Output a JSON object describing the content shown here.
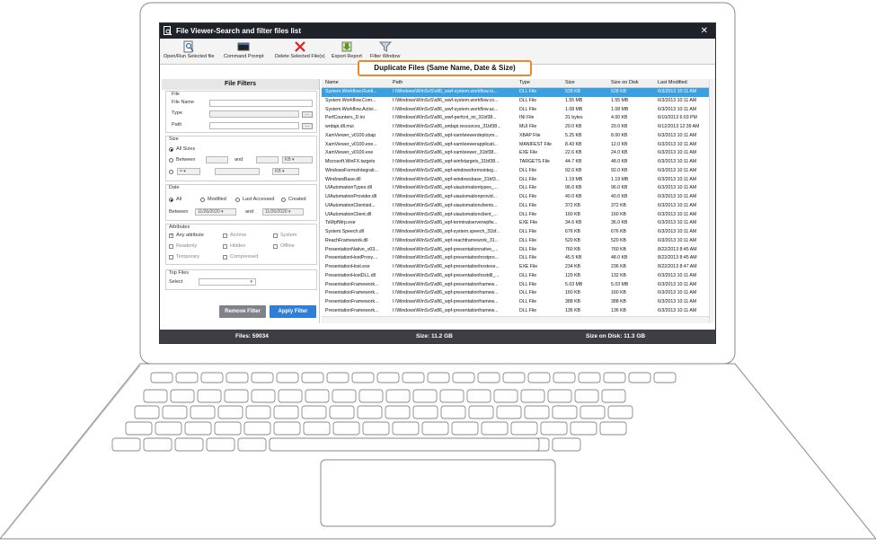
{
  "window": {
    "title": "File Viewer-Search and filter files list",
    "close_glyph": "✕"
  },
  "toolbar": {
    "buttons": [
      {
        "label": "Open/Run Selected file",
        "icon": "open-file-icon"
      },
      {
        "label": "Command Prompt",
        "icon": "command-prompt-icon"
      },
      {
        "label": "Delete Selected File(s)",
        "icon": "delete-icon"
      },
      {
        "label": "Export Report",
        "icon": "export-icon"
      },
      {
        "label": "Filter Window",
        "icon": "filter-icon"
      }
    ]
  },
  "banner": "Duplicate Files (Same Name, Date & Size)",
  "filters": {
    "heading": "File Filters",
    "file": {
      "group_label": "File",
      "name_label": "File Name",
      "type_label": "Type",
      "path_label": "Path",
      "browse": "..."
    },
    "size": {
      "group_label": "Size",
      "all_sizes": "All Sizes",
      "between": "Between",
      "and": "and",
      "unit": "KB",
      "operator": "=",
      "unit2": "KB"
    },
    "date": {
      "group_label": "Date",
      "all": "All",
      "modified": "Modified",
      "last_accessed": "Last Accessed",
      "created": "Created",
      "between": "Between",
      "from": "11/26/2020",
      "and": "and",
      "to": "11/26/2020"
    },
    "attributes": {
      "group_label": "Attributes",
      "items": [
        "Any attribute",
        "Archive",
        "System",
        "Readonly",
        "Hidden",
        "Offline",
        "Temporary",
        "Compressed"
      ],
      "checked": "Any attribute"
    },
    "top_files": {
      "group_label": "Top Files",
      "select_label": "Select"
    },
    "remove_button": "Remove Filter",
    "apply_button": "Apply Filter"
  },
  "table": {
    "columns": [
      "Name",
      "Path",
      "Type",
      "Size",
      "Size on Disk",
      "Last Modified"
    ],
    "rows": [
      [
        "System.Workflow.Runti...",
        "I:\\Windows\\WinSxS\\x86_wwf-system.workflow.ru...",
        "DLL File",
        "528 KB",
        "528 KB",
        "6/3/2013 10:11 AM"
      ],
      [
        "System.Workflow.Com...",
        "I:\\Windows\\WinSxS\\x86_wwf-system.workflow.co...",
        "DLL File",
        "1.55 MB",
        "1.55 MB",
        "6/3/2013 10:11 AM"
      ],
      [
        "System.Workflow.Activi...",
        "I:\\Windows\\WinSxS\\x86_wwf-system.workflow.ac...",
        "DLL File",
        "1.08 MB",
        "1.08 MB",
        "6/3/2013 10:11 AM"
      ],
      [
        "PerfCounters_D.ini",
        "I:\\Windows\\WinSxS\\x86_wwf-perfcnt_ini_31bf38...",
        "INI File",
        "31 bytes",
        "4.00 KB",
        "6/10/2013 6:03 PM"
      ],
      [
        "wrdapi.dll.mui",
        "I:\\Windows\\WinSxS\\x86_wrdapi.resources_31bf38...",
        "MUI File",
        "20.0 KB",
        "20.0 KB",
        "6/12/2013 12:39 AM"
      ],
      [
        "XamViewer_v0100.xbap",
        "I:\\Windows\\WinSxS\\x86_wpf-xamlviewerdeploym...",
        "XBAP File",
        "5.25 KB",
        "8.00 KB",
        "6/3/2013 10:11 AM"
      ],
      [
        "XamViewer_v0100.exe...",
        "I:\\Windows\\WinSxS\\x86_wpf-xamlviewerapplicati...",
        "MANIFEST File",
        "8.43 KB",
        "12.0 KB",
        "6/3/2013 10:11 AM"
      ],
      [
        "XamViewer_v0100.exe",
        "I:\\Windows\\WinSxS\\x86_wpf-xamlviewer_31bf38...",
        "EXE File",
        "22.6 KB",
        "24.0 KB",
        "6/3/2013 10:11 AM"
      ],
      [
        "Microsoft.WinFX.targets",
        "I:\\Windows\\WinSxS\\x86_wpf-winfxtargets_31bf38...",
        "TARGETS File",
        "44.7 KB",
        "48.0 KB",
        "6/3/2013 10:11 AM"
      ],
      [
        "WindowsFormsIntegrati...",
        "I:\\Windows\\WinSxS\\x86_wpf-windowsformsinteg...",
        "DLL File",
        "92.0 KB",
        "92.0 KB",
        "6/3/2013 10:11 AM"
      ],
      [
        "WindowsBase.dll",
        "I:\\Windows\\WinSxS\\x86_wpf-windowsbase_31bf3...",
        "DLL File",
        "1.19 MB",
        "1.19 MB",
        "6/3/2013 10:11 AM"
      ],
      [
        "UIAutomationTypes.dll",
        "I:\\Windows\\WinSxS\\x86_wpf-uiautomationtypes_...",
        "DLL File",
        "96.0 KB",
        "96.0 KB",
        "6/3/2013 10:11 AM"
      ],
      [
        "UIAutomationProvider.dll",
        "I:\\Windows\\WinSxS\\x86_wpf-uiautomationprovid...",
        "DLL File",
        "40.0 KB",
        "40.0 KB",
        "6/3/2013 10:11 AM"
      ],
      [
        "UIAutomationClientsid...",
        "I:\\Windows\\WinSxS\\x86_wpf-uiautomationclients...",
        "DLL File",
        "372 KB",
        "372 KB",
        "6/3/2013 10:11 AM"
      ],
      [
        "UIAutomationClient.dll",
        "I:\\Windows\\WinSxS\\x86_wpf-uiautomationclient_...",
        "DLL File",
        "160 KB",
        "160 KB",
        "6/3/2013 10:11 AM"
      ],
      [
        "TsWpfWrp.exe",
        "I:\\Windows\\WinSxS\\x86_wpf-terminalserverwpfw...",
        "EXE File",
        "34.6 KB",
        "36.0 KB",
        "6/3/2013 10:11 AM"
      ],
      [
        "System.Speech.dll",
        "I:\\Windows\\WinSxS\\x86_wpf-system.speech_31bf...",
        "DLL File",
        "676 KB",
        "676 KB",
        "6/3/2013 10:11 AM"
      ],
      [
        "ReachFramework.dll",
        "I:\\Windows\\WinSxS\\x86_wpf-reachframework_31...",
        "DLL File",
        "520 KB",
        "520 KB",
        "6/3/2013 10:11 AM"
      ],
      [
        "PresentationNative_v03...",
        "I:\\Windows\\WinSxS\\x86_wpf-presentationnative_...",
        "DLL File",
        "760 KB",
        "760 KB",
        "8/22/2013 8:45 AM"
      ],
      [
        "PresentationHostProxy....",
        "I:\\Windows\\WinSxS\\x86_wpf-presentationhostpro...",
        "DLL File",
        "45.5 KB",
        "48.0 KB",
        "8/22/2013 8:45 AM"
      ],
      [
        "PresentationHost.exe",
        "I:\\Windows\\WinSxS\\x86_wpf-presentationhostexe...",
        "EXE File",
        "234 KB",
        "236 KB",
        "8/22/2013 8:47 AM"
      ],
      [
        "PresentationHostDLL.dll",
        "I:\\Windows\\WinSxS\\x86_wpf-presentationhostdll_...",
        "DLL File",
        "120 KB",
        "132 KB",
        "6/3/2013 10:11 AM"
      ],
      [
        "PresentationFramework...",
        "I:\\Windows\\WinSxS\\x86_wpf-presentationframew...",
        "DLL File",
        "5.03 MB",
        "5.03 MB",
        "6/3/2013 10:11 AM"
      ],
      [
        "PresentationFramework...",
        "I:\\Windows\\WinSxS\\x86_wpf-presentationframew...",
        "DLL File",
        "160 KB",
        "160 KB",
        "6/3/2013 10:11 AM"
      ],
      [
        "PresentationFramework...",
        "I:\\Windows\\WinSxS\\x86_wpf-presentationframew...",
        "DLL File",
        "388 KB",
        "388 KB",
        "6/3/2013 10:11 AM"
      ],
      [
        "PresentationFramework...",
        "I:\\Windows\\WinSxS\\x86_wpf-presentationframew...",
        "DLL File",
        "136 KB",
        "136 KB",
        "6/3/2013 10:11 AM"
      ]
    ]
  },
  "status": {
    "files": "Files: 59034",
    "size": "Size: 11.2 GB",
    "size_on_disk": "Size on Disk: 11.3 GB"
  },
  "colors": {
    "banner_border": "#e8892c",
    "selected_row": "#3aa0e0",
    "apply_button": "#2f7ed8",
    "title_bar": "#1f2229",
    "status_bar": "#3c3f44"
  }
}
